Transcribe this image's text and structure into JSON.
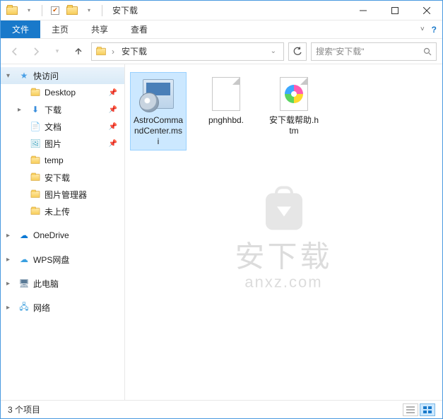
{
  "window": {
    "title": "安下载"
  },
  "ribbon": {
    "tabs": {
      "file": "文件",
      "home": "主页",
      "share": "共享",
      "view": "查看"
    }
  },
  "nav": {
    "crumb": "安下载",
    "search_placeholder": "搜索\"安下载\""
  },
  "sidebar": {
    "quick_access": "快访问",
    "items": [
      {
        "label": "Desktop",
        "pinned": true
      },
      {
        "label": "下载",
        "pinned": true
      },
      {
        "label": "文档",
        "pinned": true
      },
      {
        "label": "图片",
        "pinned": true
      },
      {
        "label": "temp",
        "pinned": false
      },
      {
        "label": "安下载",
        "pinned": false
      },
      {
        "label": "图片管理器",
        "pinned": false
      },
      {
        "label": "未上传",
        "pinned": false
      }
    ],
    "onedrive": "OneDrive",
    "wps": "WPS网盘",
    "thispc": "此电脑",
    "network": "网络"
  },
  "files": [
    {
      "name": "AstroCommandCenter.msi",
      "selected": true,
      "type": "msi"
    },
    {
      "name": "pnghhbd.",
      "selected": false,
      "type": "blank"
    },
    {
      "name": "安下载帮助.htm",
      "selected": false,
      "type": "htm"
    }
  ],
  "watermark": {
    "cn": "安下载",
    "en": "anxz.com"
  },
  "status": {
    "count": "3 个项目"
  }
}
